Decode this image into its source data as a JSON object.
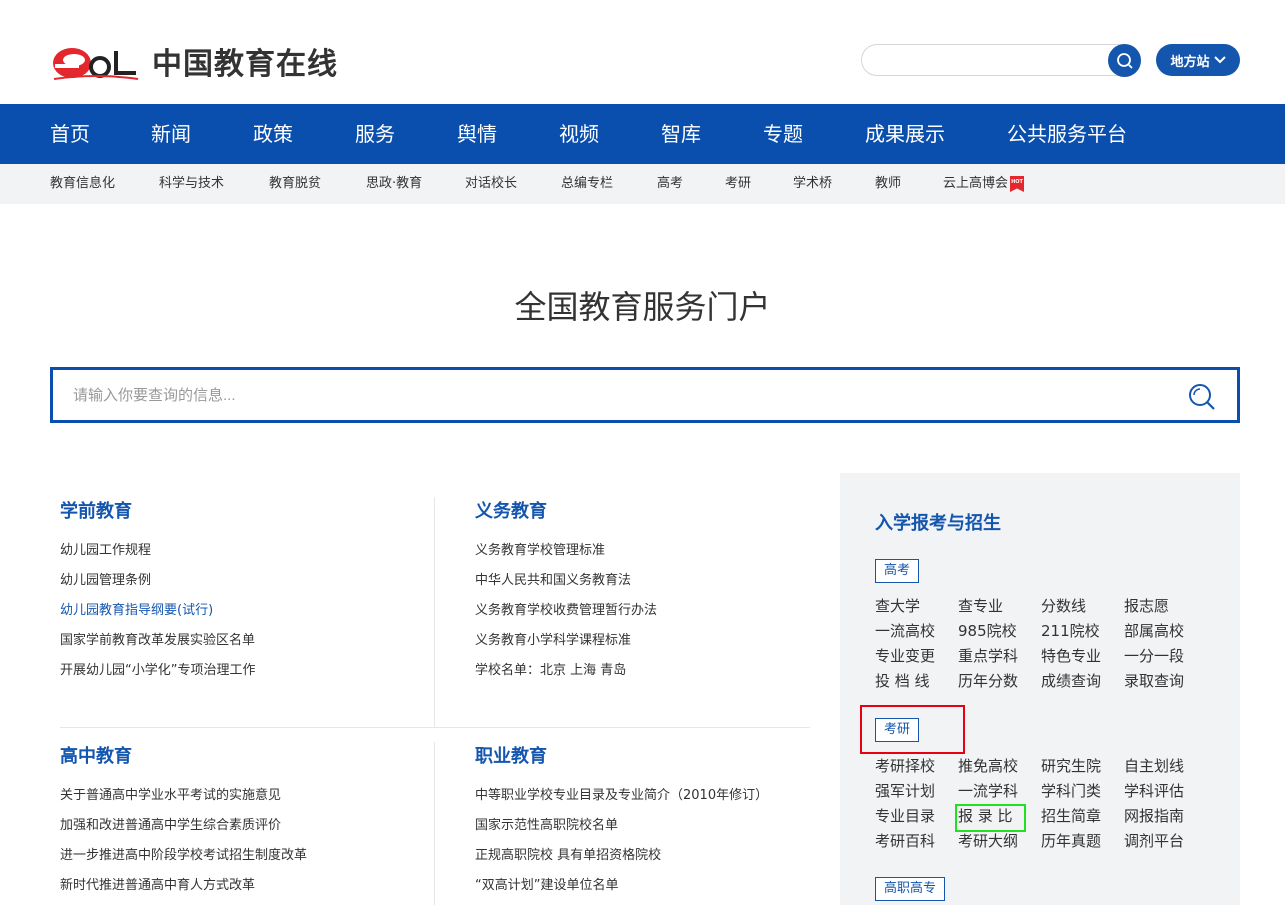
{
  "header": {
    "logo_text": "中国教育在线",
    "search_value": "",
    "region_label": "地方站"
  },
  "main_nav": [
    "首页",
    "新闻",
    "政策",
    "服务",
    "舆情",
    "视频",
    "智库",
    "专题",
    "成果展示",
    "公共服务平台"
  ],
  "sub_nav": [
    "教育信息化",
    "科学与技术",
    "教育脱贫",
    "思政·教育",
    "对话校长",
    "总编专栏",
    "高考",
    "考研",
    "学术桥",
    "教师",
    "云上高博会"
  ],
  "hot_badge": "HOT",
  "portal": {
    "title": "全国教育服务门户",
    "search_placeholder": "请输入你要查询的信息..."
  },
  "blocks": [
    {
      "title": "学前教育",
      "items": [
        "幼儿园工作规程",
        "幼儿园管理条例",
        "幼儿园教育指导纲要(试行)",
        "国家学前教育改革发展实验区名单",
        "开展幼儿园“小学化”专项治理工作"
      ]
    },
    {
      "title": "义务教育",
      "items": [
        "义务教育学校管理标准",
        "中华人民共和国义务教育法",
        "义务教育学校收费管理暂行办法",
        "义务教育小学科学课程标准",
        "学校名单：北京 上海 青岛"
      ]
    },
    {
      "title": "高中教育",
      "items": [
        "关于普通高中学业水平考试的实施意见",
        "加强和改进普通高中学生综合素质评价",
        "进一步推进高中阶段学校考试招生制度改革",
        "新时代推进普通高中育人方式改革"
      ]
    },
    {
      "title": "职业教育",
      "items": [
        "中等职业学校专业目录及专业简介（2010年修订）",
        "国家示范性高职院校名单",
        "正规高职院校 具有单招资格院校",
        "“双高计划”建设单位名单"
      ]
    }
  ],
  "right_panel": {
    "title": "入学报考与招生",
    "sections": [
      {
        "tag": "高考",
        "links": [
          "查大学",
          "查专业",
          "分数线",
          "报志愿",
          "一流高校",
          "985院校",
          "211院校",
          "部属高校",
          "专业变更",
          "重点学科",
          "特色专业",
          "一分一段",
          "投 档 线",
          "历年分数",
          "成绩查询",
          "录取查询"
        ]
      },
      {
        "tag": "考研",
        "links": [
          "考研择校",
          "推免高校",
          "研究生院",
          "自主划线",
          "强军计划",
          "一流学科",
          "学科门类",
          "学科评估",
          "专业目录",
          "报 录 比",
          "招生简章",
          "网报指南",
          "考研百科",
          "考研大纲",
          "历年真题",
          "调剂平台"
        ]
      },
      {
        "tag": "高职高专",
        "links": []
      }
    ]
  },
  "colors": {
    "brand_blue": "#0a4fae",
    "link_blue": "#1456ae",
    "highlight_red": "#e60012",
    "highlight_green": "#21e021"
  }
}
